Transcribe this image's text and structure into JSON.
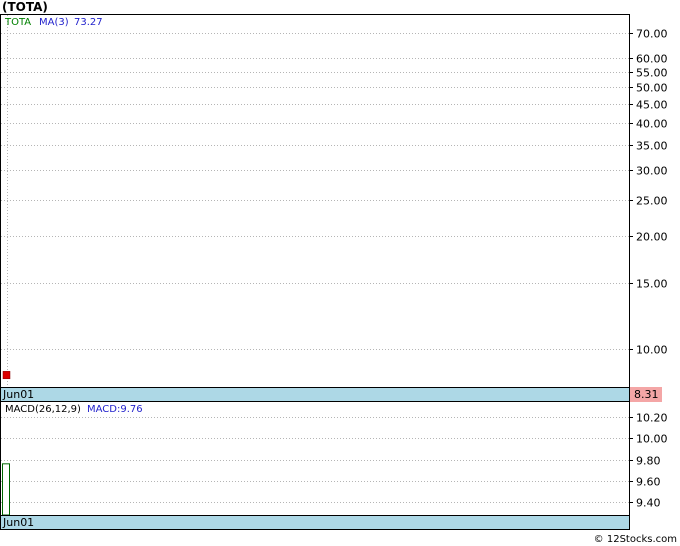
{
  "title": "(TOTA)",
  "footer": "© 12Stocks.com",
  "colors": {
    "grid": "#b5b5b5",
    "date_band": "#add8e6",
    "price_label_bg": "#f4a6a6",
    "ticker_text": "#008000",
    "ma_text": "#2222cc",
    "macd_text": "#2222cc",
    "candle_red": "#dd0000",
    "macd_bar": "#006600"
  },
  "chart_data": [
    {
      "type": "candlestick",
      "legend": {
        "ticker": "TOTA",
        "ma_label": "MA(3)",
        "ma_value": "73.27"
      },
      "scale": "log",
      "ylim": [
        7.9,
        78
      ],
      "y_ticks": [
        "70.00",
        "60.00",
        "55.00",
        "50.00",
        "45.00",
        "40.00",
        "35.00",
        "30.00",
        "25.00",
        "20.00",
        "15.00",
        "10.00"
      ],
      "x_labels": [
        "Jun01"
      ],
      "last_price": "8.31",
      "bars": [
        {
          "date": "Jun01",
          "open": 8.7,
          "high": 8.7,
          "low": 8.31,
          "close": 8.31,
          "color": "red"
        }
      ]
    },
    {
      "type": "bar",
      "legend": {
        "params": "MACD(26,12,9)",
        "macd_label": "MACD:9.76"
      },
      "ylim": [
        9.28,
        10.34
      ],
      "y_ticks": [
        "10.20",
        "10.00",
        "9.80",
        "9.60",
        "9.40"
      ],
      "x_labels": [
        "Jun01"
      ],
      "bars": [
        {
          "date": "Jun01",
          "value": 9.76
        }
      ]
    }
  ]
}
